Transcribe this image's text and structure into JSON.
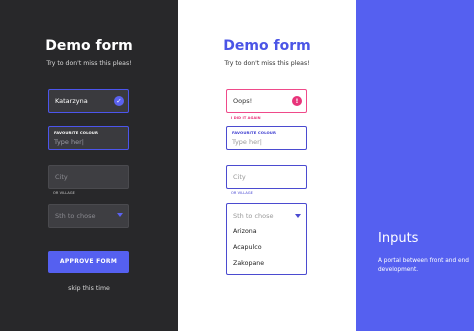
{
  "dark_form": {
    "title": "Demo form",
    "subtitle": "Try to don't miss this pleas!",
    "name_value": "Katarzyna",
    "colour_label": "FAVOURITE COLOUR",
    "colour_placeholder": "Type her|",
    "city_placeholder": "City",
    "city_helper": "OR VILLAGE",
    "select_placeholder": "Sth to chose",
    "approve_label": "APPROVE FORM",
    "skip_label": "skip this time"
  },
  "light_form": {
    "title": "Demo form",
    "subtitle": "Try to don't miss this pleas!",
    "error_value": "Oops!",
    "error_helper": "I DID IT AGAIN",
    "colour_label": "FAVOURITE COLOUR",
    "colour_placeholder": "Type her|",
    "city_placeholder": "City",
    "city_helper": "OR VILLAGE",
    "select_placeholder": "Sth to chose",
    "options": [
      "Arizona",
      "Acapulco",
      "Zakopane"
    ]
  },
  "promo": {
    "title": "Inputs",
    "description": "A portal between front and end development."
  },
  "colors": {
    "dark_bg": "#28282a",
    "accent": "#5560f0",
    "error": "#e8347a"
  },
  "icons": {
    "valid": "check-icon",
    "error": "exclamation-icon",
    "dropdown": "chevron-down-icon"
  }
}
